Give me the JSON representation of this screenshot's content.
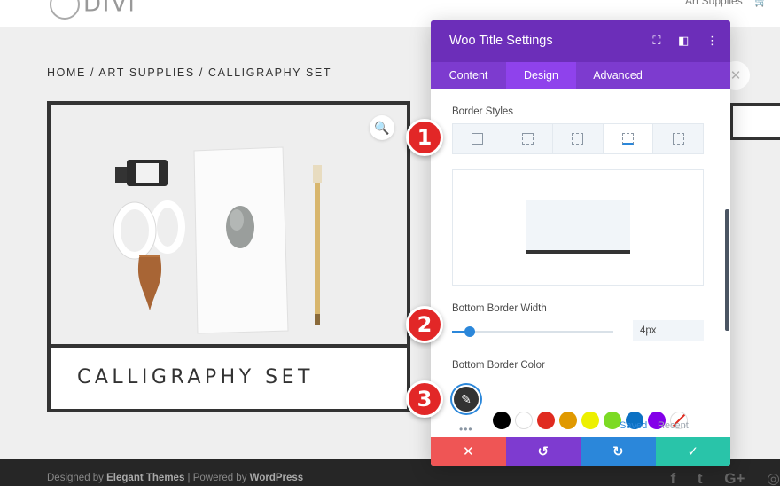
{
  "site": {
    "logo_text": "DiVi",
    "nav_link": "Art Supplies",
    "breadcrumb": "HOME / ART SUPPLIES / CALLIGRAPHY SET",
    "product_title": "CALLIGRAPHY SET",
    "footer": {
      "prefix": "Designed by",
      "theme": "Elegant Themes",
      "separator": "| Powered by",
      "platform": "WordPress"
    },
    "social_icons": [
      "facebook-icon",
      "twitter-icon",
      "google-plus-icon",
      "instagram-icon"
    ]
  },
  "modal": {
    "title": "Woo Title Settings",
    "tabs": [
      {
        "label": "Content",
        "active": false
      },
      {
        "label": "Design",
        "active": true
      },
      {
        "label": "Advanced",
        "active": false
      }
    ],
    "border_styles_label": "Border Styles",
    "border_style_options": [
      {
        "name": "all-borders",
        "active": false
      },
      {
        "name": "top-border",
        "active": false
      },
      {
        "name": "right-border",
        "active": false
      },
      {
        "name": "bottom-border",
        "active": true
      },
      {
        "name": "left-border",
        "active": false
      }
    ],
    "bottom_border_width_label": "Bottom Border Width",
    "bottom_border_width_value": "4px",
    "slider_level_percent": 11,
    "bottom_border_color_label": "Bottom Border Color",
    "selected_color": "#333333",
    "swatches": [
      "#000000",
      "#ffffff",
      "#e02b20",
      "#e09900",
      "#edf000",
      "#7cda24",
      "#0c71c3",
      "#8300e9",
      "none"
    ],
    "palette_tabs": [
      {
        "label": "Saved",
        "active": true
      },
      {
        "label": "Recent",
        "active": false
      }
    ],
    "footer_buttons": [
      {
        "name": "cancel",
        "color": "#ef5555",
        "glyph": "✕"
      },
      {
        "name": "undo",
        "color": "#7e3bd0",
        "glyph": "↺"
      },
      {
        "name": "redo",
        "color": "#2b87da",
        "glyph": "↻"
      },
      {
        "name": "save",
        "color": "#29c4a9",
        "glyph": "✓"
      }
    ]
  },
  "callouts": [
    "1",
    "2",
    "3"
  ],
  "colors": {
    "modal_header": "#6c2eb9",
    "tab_bar": "#7d3bcf",
    "active_tab": "#8f42ec",
    "accent_blue": "#2b87da",
    "callout_red": "#e22727"
  }
}
